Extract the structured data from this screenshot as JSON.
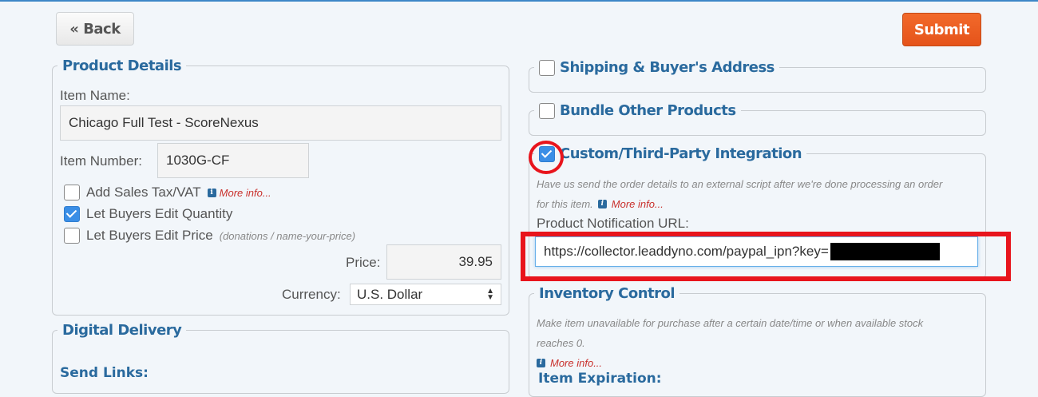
{
  "toolbar": {
    "back_label": "« Back",
    "submit_label": "Submit"
  },
  "product_details": {
    "legend": "Product Details",
    "item_name_label": "Item Name:",
    "item_name_value": "Chicago Full Test - ScoreNexus",
    "item_number_label": "Item Number:",
    "item_number_value": "1030G-CF",
    "sales_tax_label": "Add Sales Tax/VAT",
    "sales_tax_checked": false,
    "more_info": "More info...",
    "edit_quantity_label": "Let Buyers Edit Quantity",
    "edit_quantity_checked": true,
    "edit_price_label": "Let Buyers Edit Price",
    "edit_price_hint": "(donations / name-your-price)",
    "edit_price_checked": false,
    "price_label": "Price:",
    "price_value": "39.95",
    "currency_label": "Currency:",
    "currency_value": "U.S. Dollar"
  },
  "digital_delivery": {
    "legend": "Digital Delivery",
    "send_links_label": "Send Links:"
  },
  "shipping": {
    "legend": "Shipping & Buyer's Address",
    "checked": false
  },
  "bundle": {
    "legend": "Bundle Other Products",
    "checked": false
  },
  "integration": {
    "legend": "Custom/Third-Party Integration",
    "checked": true,
    "description_line1": "Have us send the order details to an external script after we're done processing an order",
    "description_line2": "for this item.",
    "more_info": "More info...",
    "url_label": "Product Notification URL:",
    "url_value": "https://collector.leaddyno.com/paypal_ipn?key="
  },
  "inventory": {
    "legend": "Inventory Control",
    "description_line1": "Make item unavailable for purchase after a certain date/time or when available stock",
    "description_line2": "reaches 0.",
    "more_info": "More info...",
    "cutoff_label": "Item Expiration:"
  },
  "colors": {
    "accent": "#2a6a9e",
    "submit": "#e8561c",
    "checkbox_checked": "#3a8ee6",
    "annotation": "#e8141c",
    "link_red": "#c9302c"
  }
}
